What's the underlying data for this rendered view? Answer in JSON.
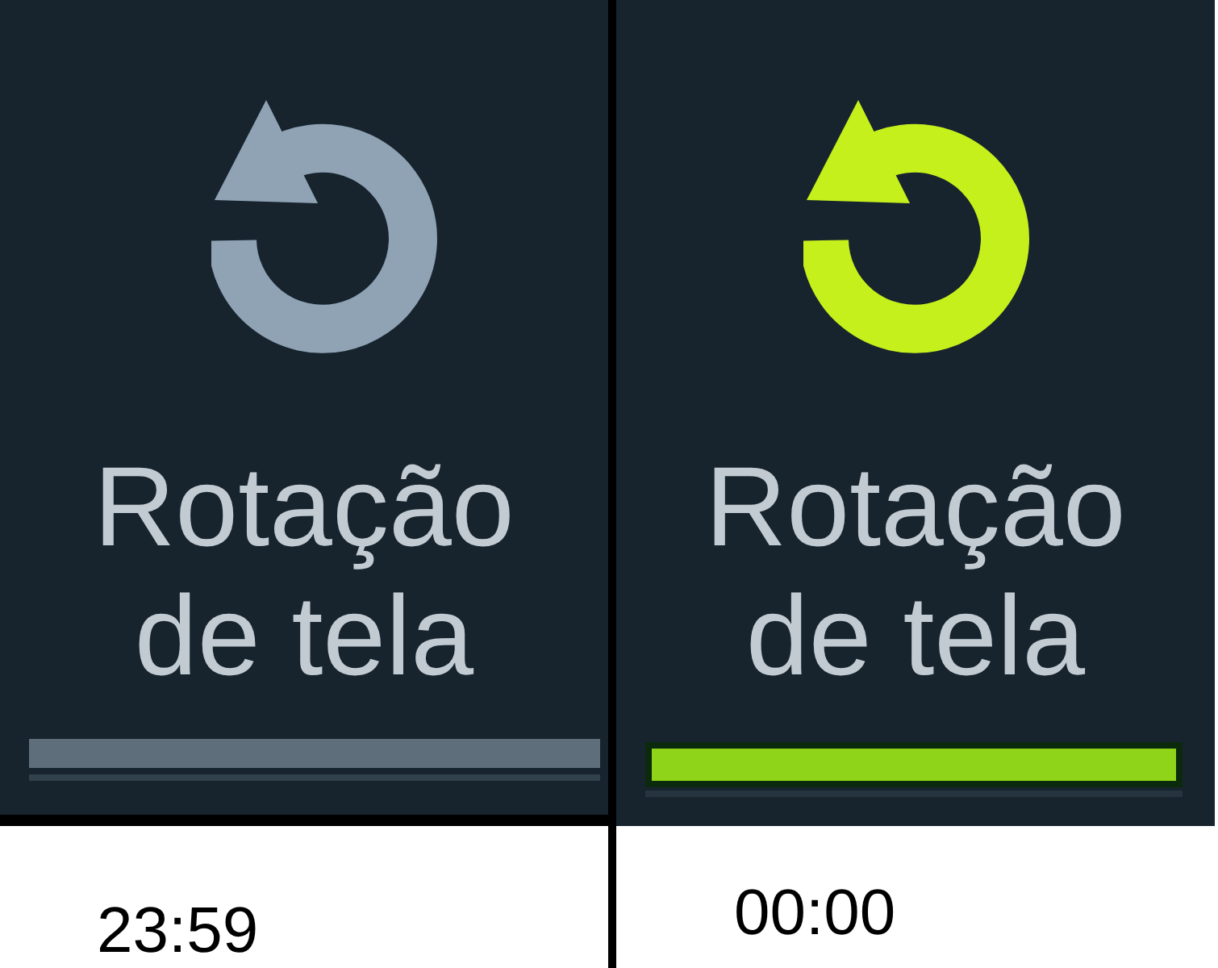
{
  "tiles": [
    {
      "label": "Rotação de tela",
      "on": false,
      "caption": "23:59"
    },
    {
      "label": "Rotação de tela",
      "on": true,
      "caption": "00:00"
    }
  ]
}
